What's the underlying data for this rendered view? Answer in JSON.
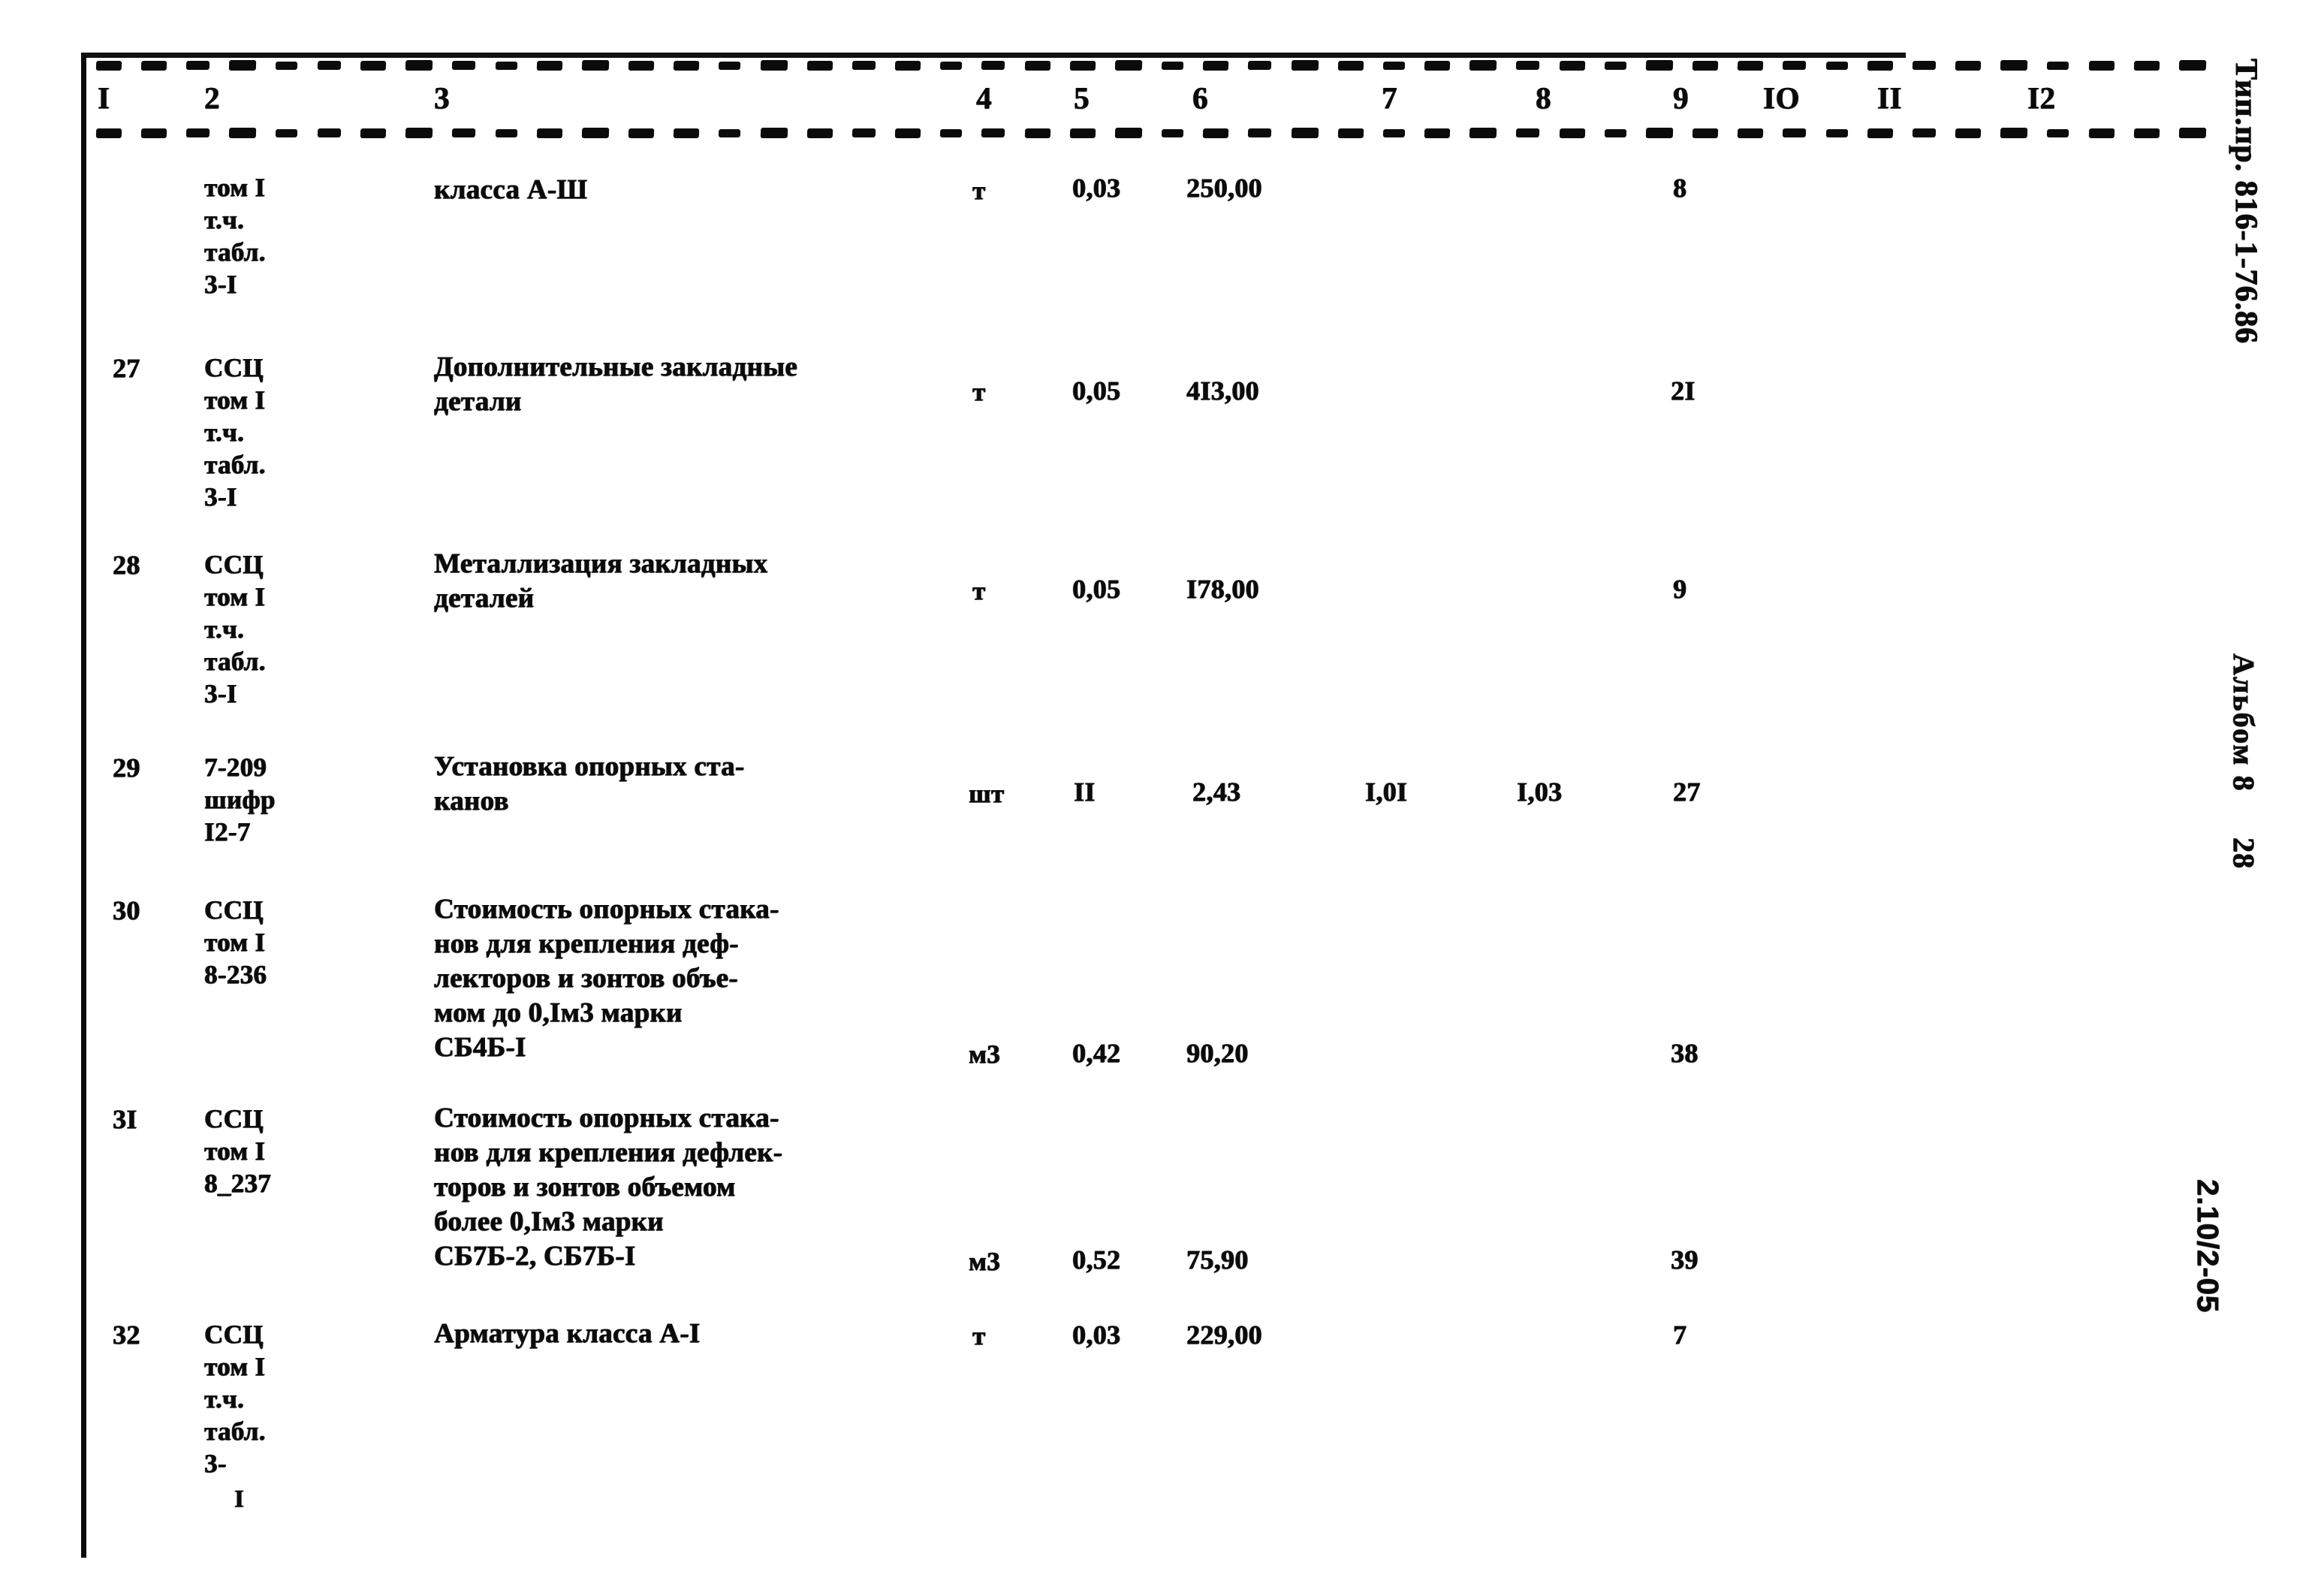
{
  "document": {
    "type": "smeta-table",
    "project_stamp": "Тип.пр. 816-1-76.86",
    "album_stamp": "Альбом 8",
    "page_stamp": "28",
    "code_stamp": "2.10/2-05"
  },
  "table": {
    "column_headers": [
      "I",
      "2",
      "3",
      "4",
      "5",
      "6",
      "7",
      "8",
      "9",
      "IO",
      "II",
      "I2"
    ],
    "rows": [
      {
        "no": "",
        "ref": "том I\nт.ч.\nтабл.\n3-I",
        "desc": "класса А-Ш",
        "unit": "т",
        "c5": "0,03",
        "c6": "250,00",
        "c7": "",
        "c8": "",
        "c9": "8",
        "c10": "",
        "c11": "",
        "c12": ""
      },
      {
        "no": "27",
        "ref": "ССЦ\nтом I\nт.ч.\nтабл.\n3-I",
        "desc": "Дополнительные закладные\nдетали",
        "unit": "т",
        "c5": "0,05",
        "c6": "4I3,00",
        "c7": "",
        "c8": "",
        "c9": "2I",
        "c10": "",
        "c11": "",
        "c12": ""
      },
      {
        "no": "28",
        "ref": "ССЦ\nтом I\nт.ч.\nтабл.\n3-I",
        "desc": "Металлизация закладных\nдеталей",
        "unit": "т",
        "c5": "0,05",
        "c6": "I78,00",
        "c7": "",
        "c8": "",
        "c9": "9",
        "c10": "",
        "c11": "",
        "c12": ""
      },
      {
        "no": "29",
        "ref": "7-209\nшифр\nI2-7",
        "desc": "Установка опорных ста-\nканов",
        "unit": "шт",
        "c5": "II",
        "c6": "2,43",
        "c7": "I,0I",
        "c8": "I,03",
        "c9": "27",
        "c10": "",
        "c11": "",
        "c12": ""
      },
      {
        "no": "30",
        "ref": "ССЦ\nтом I\n8-236",
        "desc": "Стоимость опорных стака-\nнов для крепления деф-\nлекторов и зонтов объе-\nмом до 0,Iм3 марки\nСБ4Б-I",
        "unit": "м3",
        "c5": "0,42",
        "c6": "90,20",
        "c7": "",
        "c8": "",
        "c9": "38",
        "c10": "",
        "c11": "",
        "c12": ""
      },
      {
        "no": "3I",
        "ref": "ССЦ\nтом I\n8_237",
        "desc": "Стоимость опорных стака-\nнов для крепления дефлек-\nторов и зонтов объемом\nболее 0,Iм3 марки\nСБ7Б-2, СБ7Б-I",
        "unit": "м3",
        "c5": "0,52",
        "c6": "75,90",
        "c7": "",
        "c8": "",
        "c9": "39",
        "c10": "",
        "c11": "",
        "c12": ""
      },
      {
        "no": "32",
        "ref": "ССЦ\nтом I\nт.ч.\nтабл.\n3-",
        "ref_tail": "I",
        "desc": "Арматура класса А-I",
        "unit": "т",
        "c5": "0,03",
        "c6": "229,00",
        "c7": "",
        "c8": "",
        "c9": "7",
        "c10": "",
        "c11": "",
        "c12": ""
      }
    ]
  }
}
